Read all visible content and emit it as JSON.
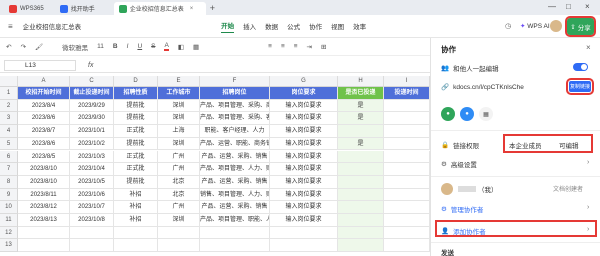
{
  "titlebar": {
    "tabs": [
      {
        "label": "WPS365",
        "icon": "wps-logo-icon"
      },
      {
        "label": "找开助手",
        "icon": "doc-icon"
      },
      {
        "label": "企业校招信息汇总表",
        "icon": "sheet-icon",
        "close": "×"
      }
    ],
    "add_tab": "+",
    "controls": {
      "min": "—",
      "max": "□",
      "close": "×"
    }
  },
  "menubar": {
    "menu_icon": "≡",
    "file_title": "企业校招信息汇总表",
    "items": [
      "开始",
      "插入",
      "数据",
      "公式",
      "协作",
      "视图",
      "效率"
    ],
    "active": "开始",
    "wps_ai": "WPS AI",
    "share": "分享"
  },
  "toolbar": {
    "font_name": "微软雅黑",
    "font_size": "11",
    "bold": "B",
    "italic": "I",
    "underline": "U",
    "strike": "S",
    "font_color": "A"
  },
  "formula": {
    "cell_ref": "L13",
    "fx": "fx"
  },
  "sheet": {
    "columns": [
      "A",
      "C",
      "D",
      "E",
      "F",
      "G",
      "H",
      "I"
    ],
    "header": [
      "校招开始时间",
      "截止投递时间",
      "招聘性质",
      "工作城市",
      "招聘岗位",
      "岗位要求",
      "是否已投递",
      "投递时间"
    ],
    "rows": [
      [
        "2023/8/4",
        "2023/9/29",
        "提前批",
        "深圳",
        "产品、项目管理、采购、商务销售",
        "输入岗位要求",
        "是",
        ""
      ],
      [
        "2023/8/6",
        "2023/9/30",
        "提前批",
        "深圳",
        "产品、项目管理、采购、客户经理",
        "输入岗位要求",
        "是",
        ""
      ],
      [
        "2023/8/7",
        "2023/10/1",
        "正式批",
        "上海",
        "职能、客户经理、人力",
        "输入岗位要求",
        "",
        ""
      ],
      [
        "2023/8/6",
        "2023/10/2",
        "提前批",
        "深圳",
        "产品、运营、职能、商务销售",
        "输入岗位要求",
        "是",
        ""
      ],
      [
        "2023/8/5",
        "2023/10/3",
        "正式批",
        "广州",
        "产品、运营、采购、销售",
        "输入岗位要求",
        "",
        ""
      ],
      [
        "2023/8/10",
        "2023/10/4",
        "正式批",
        "广州",
        "产品、项目管理、人力、财务",
        "输入岗位要求",
        "",
        ""
      ],
      [
        "2023/8/10",
        "2023/10/5",
        "提前批",
        "北京",
        "产品、运营、采购、销售",
        "输入岗位要求",
        "",
        ""
      ],
      [
        "2023/8/11",
        "2023/10/6",
        "补招",
        "北京",
        "销售、项目管理、人力、财务",
        "输入岗位要求",
        "",
        ""
      ],
      [
        "2023/8/12",
        "2023/10/7",
        "补招",
        "广州",
        "产品、运营、采购、销售",
        "输入岗位要求",
        "",
        ""
      ],
      [
        "2023/8/13",
        "2023/10/8",
        "补招",
        "深圳",
        "产品、项目管理、职能、人力",
        "输入岗位要求",
        "",
        ""
      ]
    ],
    "row_numbers": [
      "1",
      "2",
      "3",
      "4",
      "5",
      "6",
      "7",
      "8",
      "9",
      "10",
      "11",
      "12",
      "13"
    ]
  },
  "panel": {
    "title": "协作",
    "close": "×",
    "edit_with": "和他人一起编辑",
    "link": "kdocs.cn/l/cpCTKnlsChe",
    "copy_link": "复制链接",
    "permission_label": "链接权限",
    "permission_scope": "本企业成员",
    "permission_level": "可编辑",
    "advanced": "高级设置",
    "owner_suffix": "（我）",
    "owner_role": "文档创建者",
    "manage": "管理协作者",
    "add": "添加协作者",
    "send": "发送"
  },
  "colors": {
    "header_blue": "#4f6fd9",
    "header_green": "#6fc24a",
    "accent_green": "#2fa55a",
    "highlight_red": "#e53935",
    "link_blue": "#2f6bf5"
  }
}
